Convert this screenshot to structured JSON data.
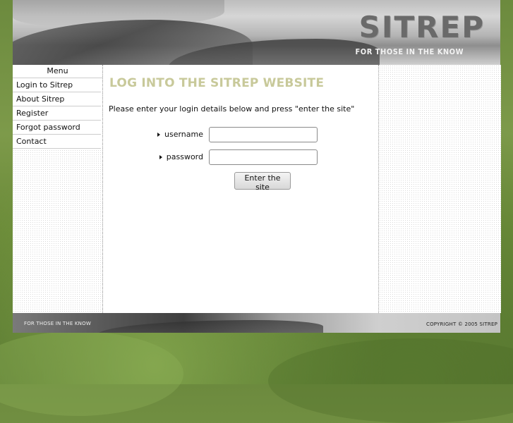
{
  "header": {
    "logo": "SITREP",
    "tagline": "FOR THOSE IN THE KNOW"
  },
  "menu": {
    "title": "Menu",
    "items": [
      {
        "label": "Login to Sitrep"
      },
      {
        "label": "About Sitrep"
      },
      {
        "label": "Register"
      },
      {
        "label": "Forgot password"
      },
      {
        "label": "Contact"
      }
    ]
  },
  "main": {
    "title": "LOG INTO THE SITREP WEBSITE",
    "instructions": "Please enter your login details below and press \"enter the site\"",
    "username_label": "username",
    "password_label": "password",
    "username_value": "",
    "password_value": "",
    "submit_label": "Enter the site",
    "title_color": "#c8c99a"
  },
  "footer": {
    "tagline": "FOR THOSE IN THE KNOW",
    "copyright": "COPYRIGHT © 2005 SITREP"
  }
}
